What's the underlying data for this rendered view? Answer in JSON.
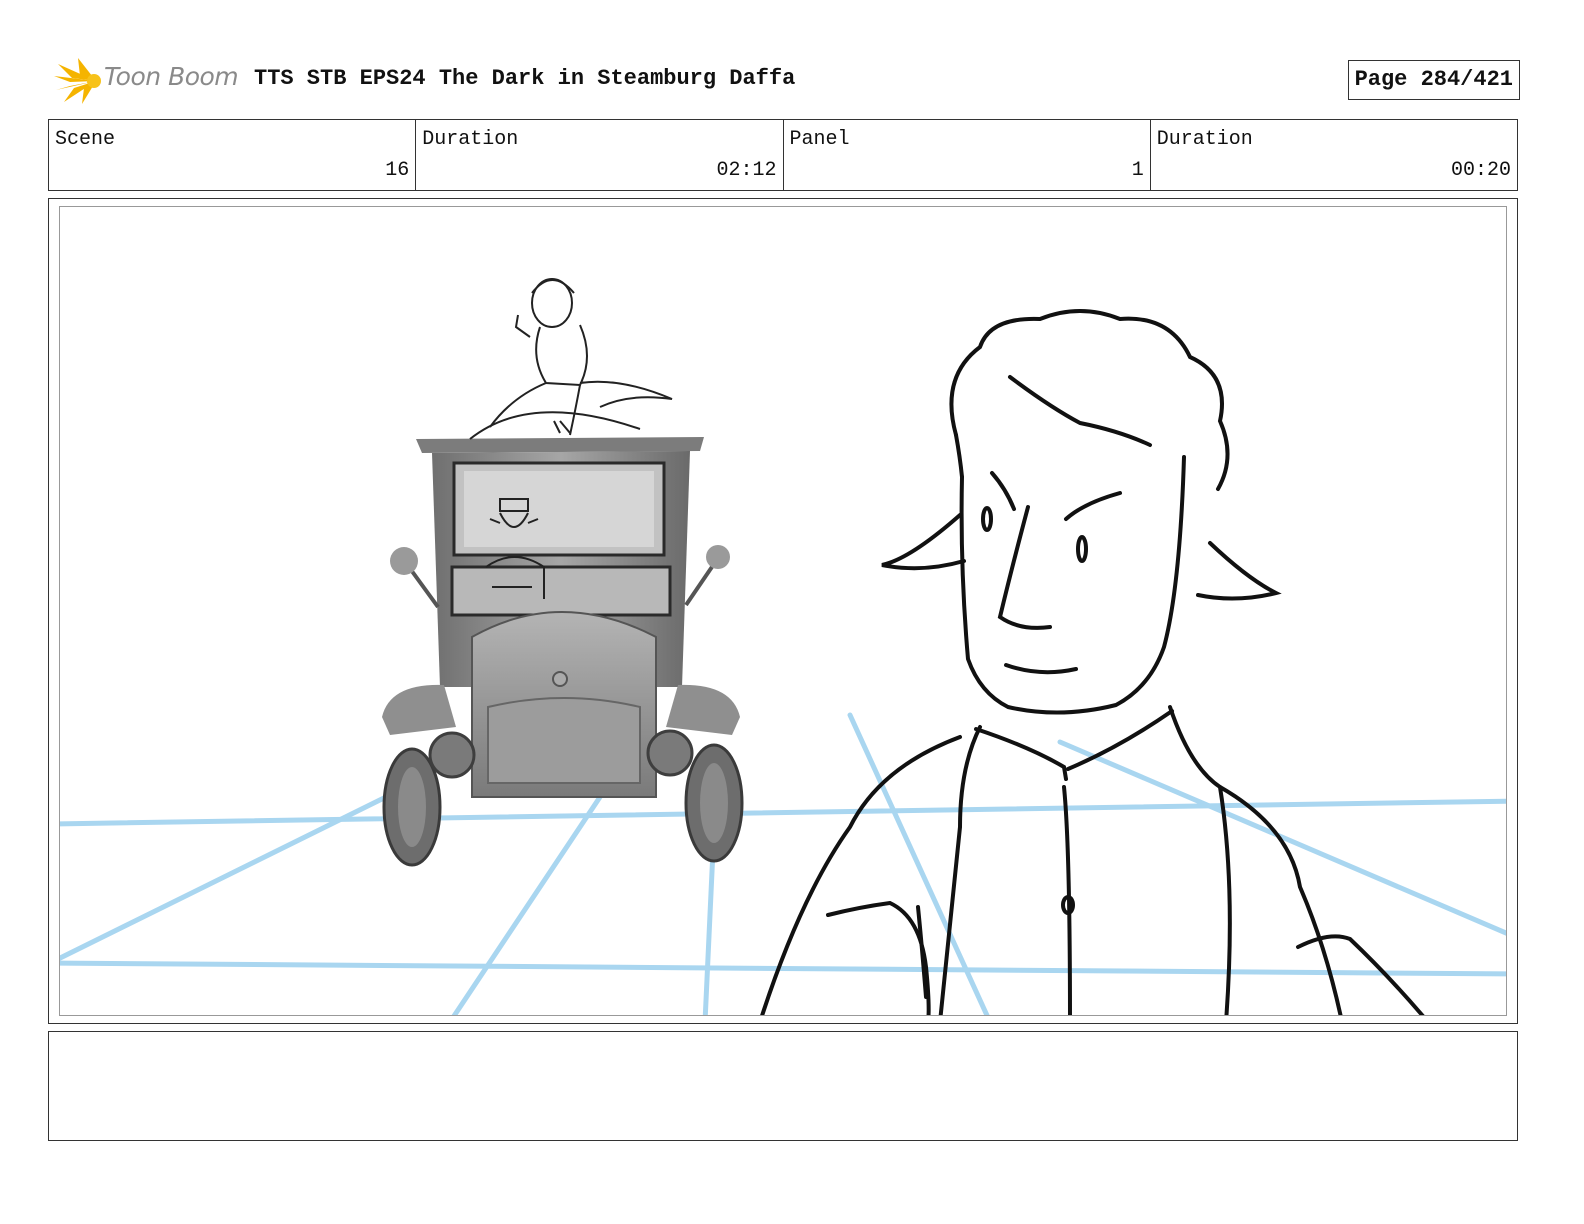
{
  "header": {
    "logo_text": "Toon Boom",
    "title": "TTS STB EPS24 The Dark in Steamburg Daffa",
    "page": "Page 284/421"
  },
  "info": {
    "scene_label": "Scene",
    "scene_value": "16",
    "scene_duration_label": "Duration",
    "scene_duration_value": "02:12",
    "panel_label": "Panel",
    "panel_value": "1",
    "panel_duration_label": "Duration",
    "panel_duration_value": "00:20"
  },
  "panel": {
    "grid_color": "#a9d6f0",
    "sketch_color": "#111111",
    "car_color": "#8c8c8c"
  },
  "notes": {
    "text": ""
  }
}
